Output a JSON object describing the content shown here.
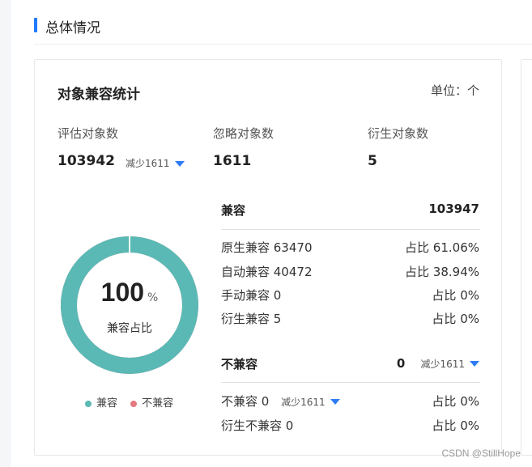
{
  "section": {
    "title": "总体情况"
  },
  "card": {
    "title": "对象兼容统计",
    "unit": "单位：个",
    "stats": [
      {
        "label": "评估对象数",
        "value": "103942",
        "delta": "减少1611"
      },
      {
        "label": "忽略对象数",
        "value": "1611"
      },
      {
        "label": "衍生对象数",
        "value": "5"
      }
    ],
    "donut": {
      "value": "100",
      "unit": "%",
      "label": "兼容占比",
      "compatible_fraction": 1.0,
      "colors": {
        "compatible": "#5ab9b5",
        "incompatible": "#e27a7f"
      }
    },
    "legend": [
      {
        "label": "兼容",
        "color": "#5ab9b5"
      },
      {
        "label": "不兼容",
        "color": "#e27a7f"
      }
    ],
    "compatible": {
      "title": "兼容",
      "total": "103947",
      "rows": [
        {
          "label": "原生兼容 63470",
          "ratio": "占比 61.06%"
        },
        {
          "label": "自动兼容 40472",
          "ratio": "占比 38.94%"
        },
        {
          "label": "手动兼容 0",
          "ratio": "占比 0%"
        },
        {
          "label": "衍生兼容 5",
          "ratio": "占比 0%"
        }
      ]
    },
    "incompatible": {
      "title": "不兼容",
      "total": "0",
      "delta": "减少1611",
      "rows": [
        {
          "label": "不兼容 0",
          "delta": "减少1611",
          "ratio": "占比 0%"
        },
        {
          "label": "衍生不兼容 0",
          "ratio": "占比 0%"
        }
      ]
    }
  },
  "icons": {
    "delta": "triangle-down-icon"
  },
  "accent": "#1f7bff",
  "watermark": "CSDN @StillHope"
}
